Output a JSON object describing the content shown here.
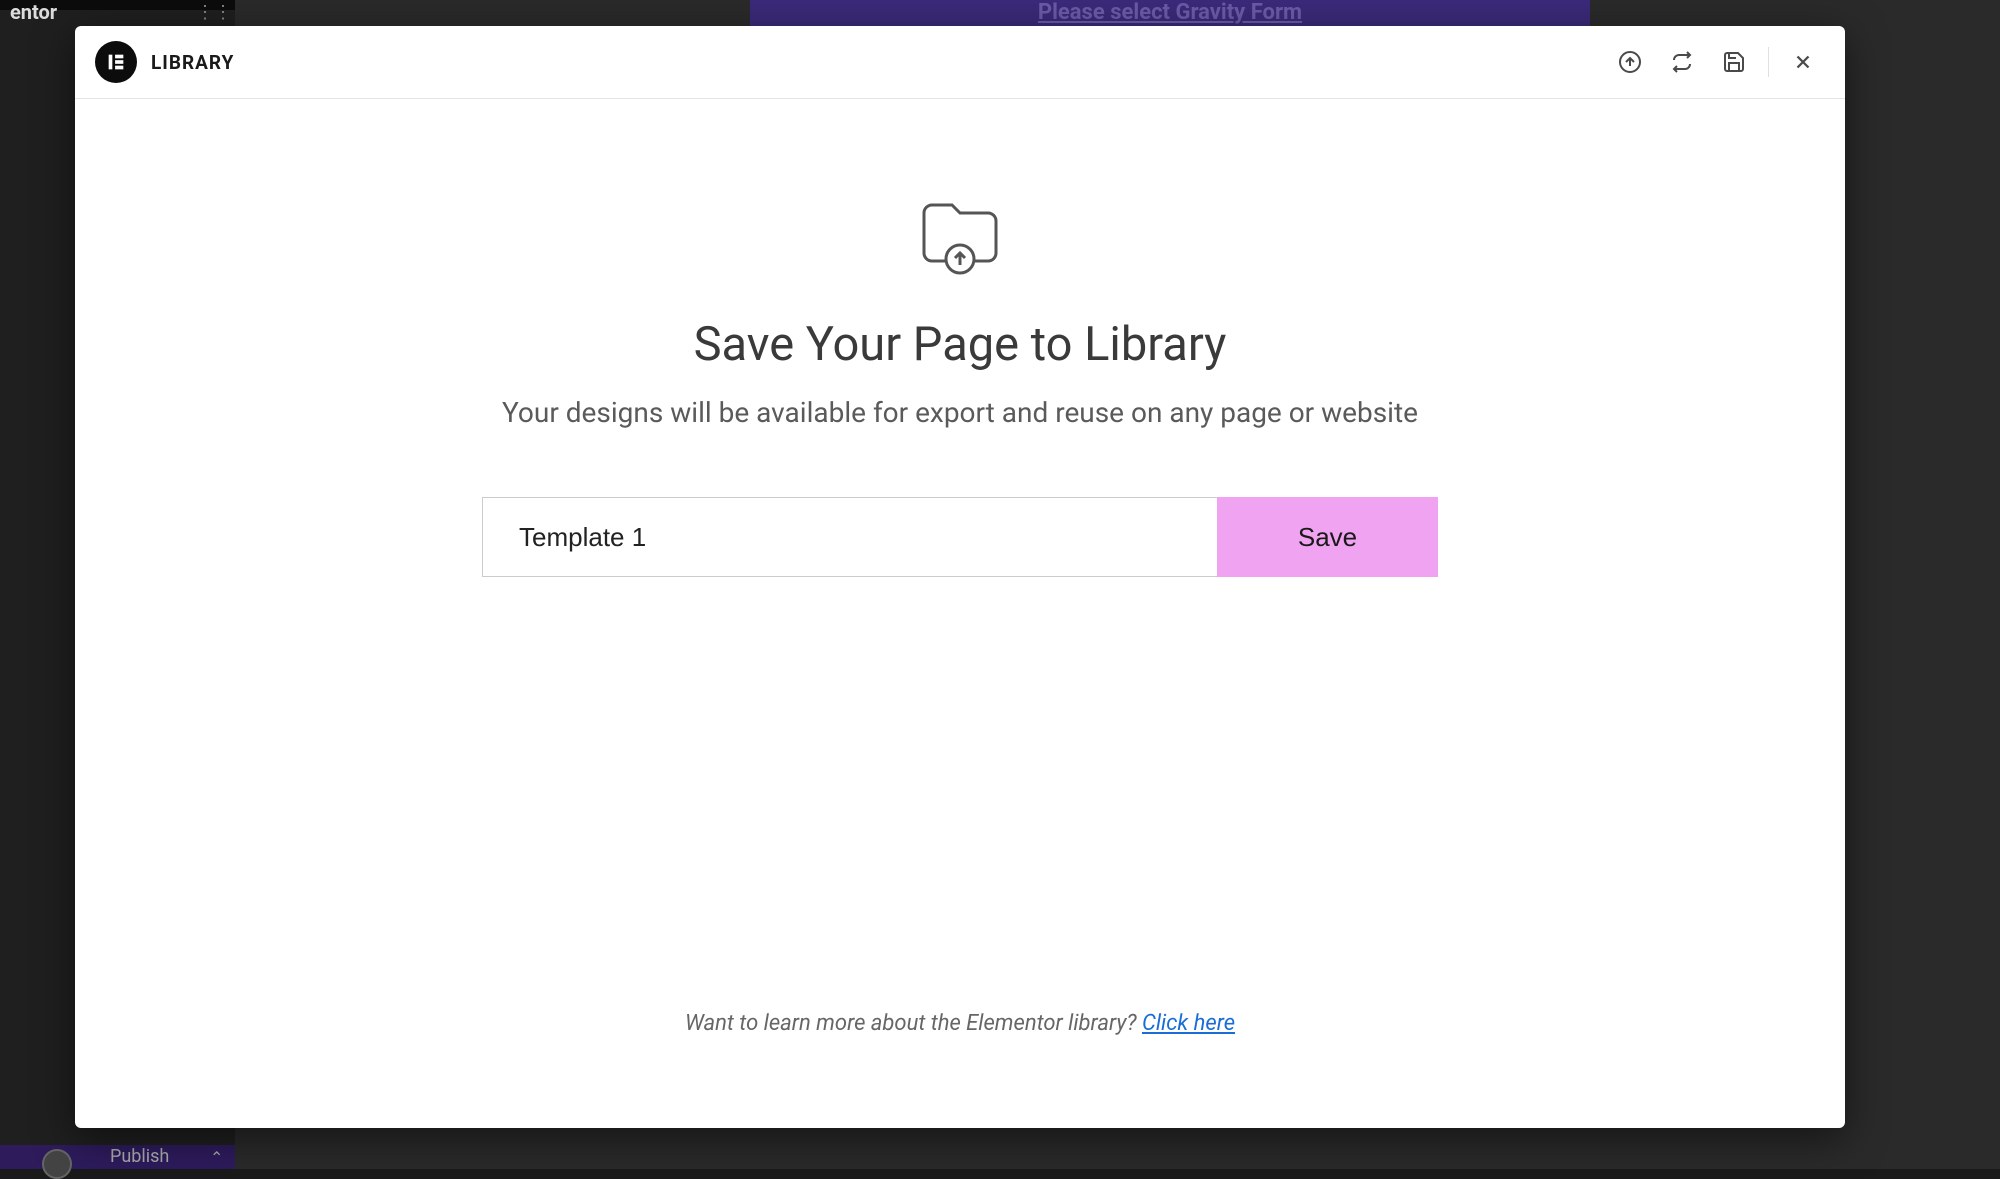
{
  "background": {
    "sidebar_title": "entor",
    "purple_box_text": "Please select Gravity Form",
    "publish_text": "Publish"
  },
  "modal": {
    "header": {
      "title": "LIBRARY"
    },
    "body": {
      "heading": "Save Your Page to Library",
      "subheading": "Your designs will be available for export and reuse on any page or website",
      "input_value": "Template 1",
      "save_button": "Save",
      "footer_question": "Want to learn more about the Elementor library? ",
      "footer_link": "Click here"
    }
  }
}
